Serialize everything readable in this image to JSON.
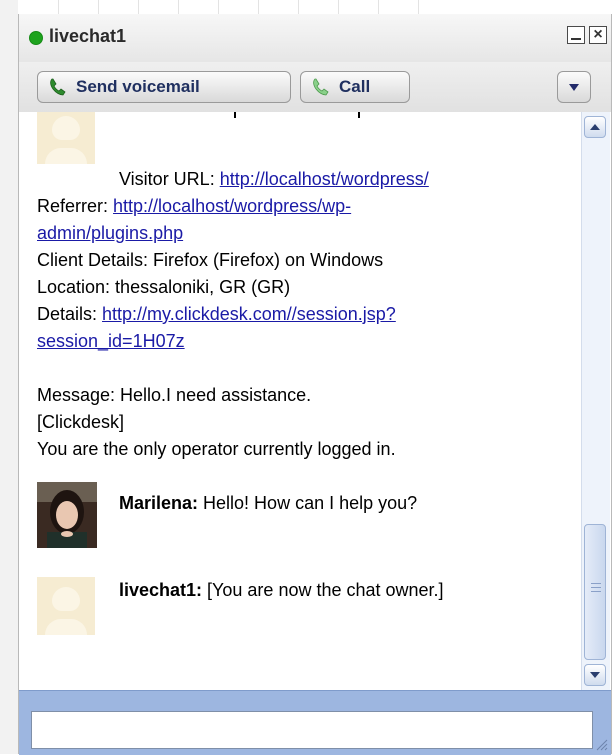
{
  "window": {
    "title": "livechat1",
    "status_color": "#1ea31e"
  },
  "toolbar": {
    "send_voicemail_label": "Send voicemail",
    "call_label": "Call",
    "phone_icon": "phone-icon",
    "dropdown_icon": "chevron-down-icon"
  },
  "chat": {
    "visitor_url_label": "Visitor URL: ",
    "visitor_url": "http://localhost/wordpress/",
    "referrer_label": "Referrer: ",
    "referrer_url_line1": "http://localhost/wordpress/wp-",
    "referrer_url_line2": "admin/plugins.php",
    "client_details": "Client Details: Firefox (Firefox) on Windows",
    "location": "Location: thessaloniki, GR (GR)",
    "details_label": "Details: ",
    "details_url_line1": "http://my.clickdesk.com//session.jsp?",
    "details_url_line2": "session_id=1H07z",
    "message": "Message: Hello.I need assistance.",
    "clickdesk_tag": "[Clickdesk]",
    "operator_note": "You are the only operator currently logged in.",
    "messages": [
      {
        "sender": "Marilena:",
        "text": " Hello! How can I help you?"
      },
      {
        "sender": "livechat1:",
        "text": " [You are now the chat owner.]"
      }
    ]
  },
  "input": {
    "value": "",
    "placeholder": ""
  }
}
